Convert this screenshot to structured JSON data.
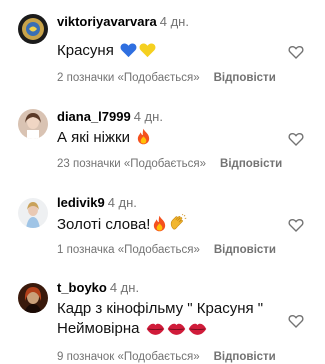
{
  "comments": [
    {
      "username": "viktoriyavarvara",
      "time": "4 дн.",
      "text": "Красуня",
      "emoji": [
        "blue-heart-icon",
        "yellow-heart-icon"
      ],
      "likes": "2 позначки «Подобається»",
      "reply": "Відповісти"
    },
    {
      "username": "diana_l7999",
      "time": "4 дн.",
      "text": "А які ніжки",
      "emoji": [
        "fire-icon"
      ],
      "likes": "23 позначки «Подобається»",
      "reply": "Відповісти"
    },
    {
      "username": "ledivik9",
      "time": "4 дн.",
      "text": "Золоті слова!",
      "emoji": [
        "fire-icon",
        "clapping-hands-icon"
      ],
      "likes": "1 позначка «Подобається»",
      "reply": "Відповісти"
    },
    {
      "username": "t_boyko",
      "time": "4 дн.",
      "text_line1": "Кадр з кінофільму \" Красуня \"",
      "text_line2": "Неймовірна",
      "emoji": [
        "red-lips-icon",
        "red-lips-icon",
        "red-lips-icon"
      ],
      "likes": "9 позначок «Подобається»",
      "reply": "Відповісти"
    }
  ],
  "colors": {
    "secondary_text": "#737373",
    "primary_text": "#000000",
    "heart_outline": "#737373"
  }
}
